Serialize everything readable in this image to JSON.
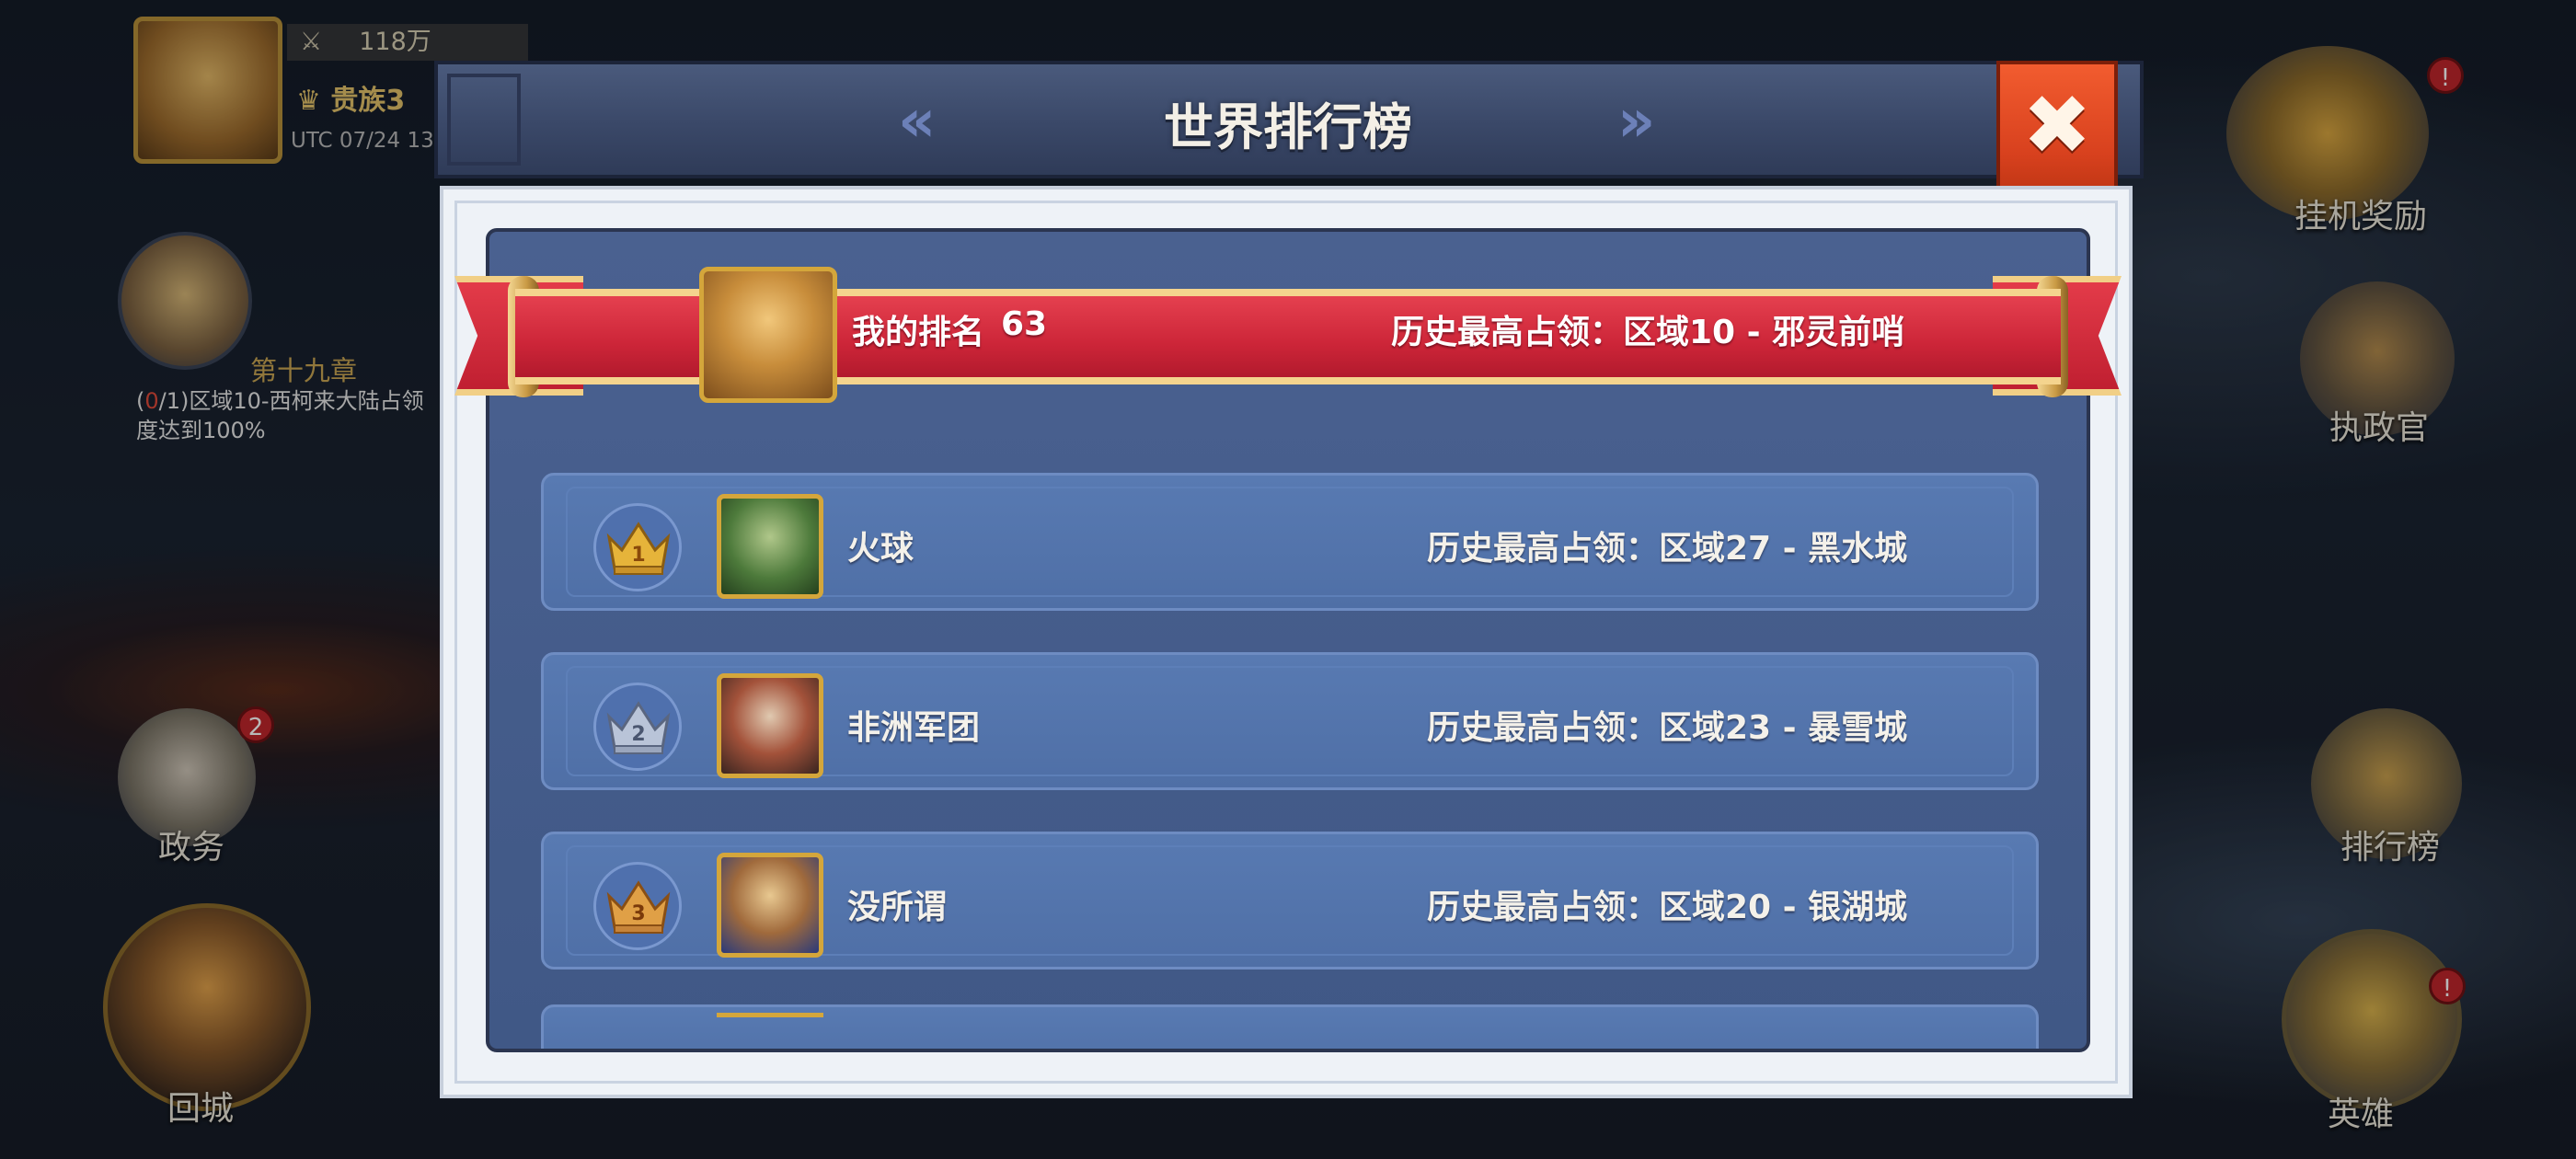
{
  "hud": {
    "power": "118万",
    "noble_label": "贵族3",
    "utc_time": "UTC 07/24 13:",
    "chapter": "第十九章",
    "quest_progress_done": "0",
    "quest_text": "/1)区域10-西柯来大陆占领度达到100%"
  },
  "side_buttons": {
    "policy": {
      "label": "政务",
      "badge": "2"
    },
    "return_city": {
      "label": "回城"
    },
    "idle_reward": {
      "label": "挂机奖励",
      "badge": "!"
    },
    "governor": {
      "label": "执政官"
    },
    "leaderboard": {
      "label": "排行榜"
    },
    "hero": {
      "label": "英雄",
      "badge": "!"
    }
  },
  "modal": {
    "title": "世界排行榜",
    "close_glyph": "✖",
    "prev_glyph": "«",
    "next_glyph": "»"
  },
  "my_rank": {
    "label": "我的排名",
    "value": "63",
    "history": "历史最高占领：区域10 - 邪灵前哨"
  },
  "rankings": [
    {
      "rank": "1",
      "name": "火球",
      "history": "历史最高占领：区域27 - 黑水城",
      "medal": "gold",
      "medal_color": "#e6b43a"
    },
    {
      "rank": "2",
      "name": "非洲军团",
      "history": "历史最高占领：区域23 - 暴雪城",
      "medal": "silver",
      "medal_color": "#b9c4d8"
    },
    {
      "rank": "3",
      "name": "没所谓",
      "history": "历史最高占领：区域20 - 银湖城",
      "medal": "bronze",
      "medal_color": "#e0a046"
    }
  ],
  "colors": {
    "banner_red": "#cc2538",
    "panel_blue": "#4a6190",
    "close_orange": "#e04a1f",
    "frame_gold": "#d4a63b"
  }
}
